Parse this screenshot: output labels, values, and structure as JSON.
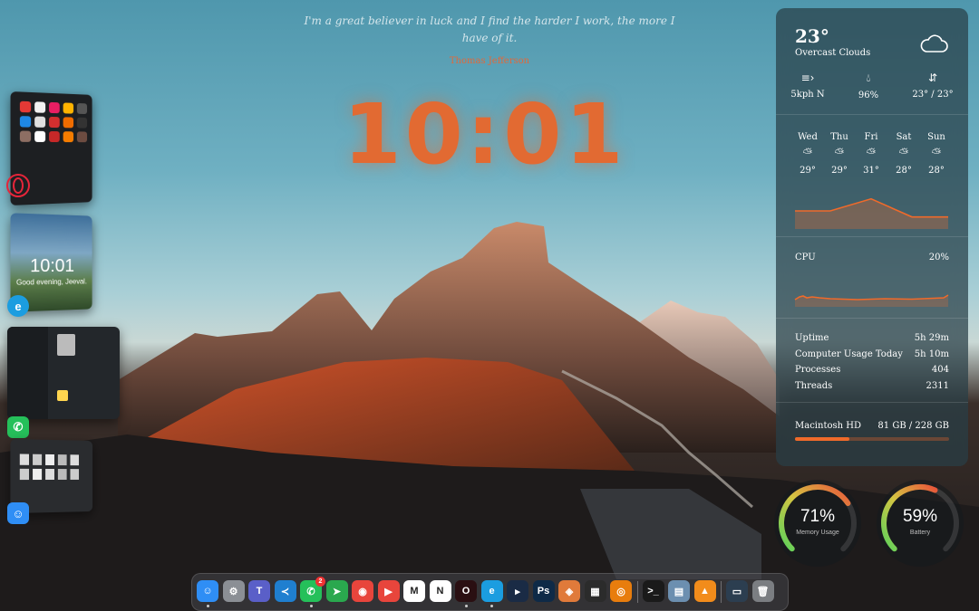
{
  "desktop": {
    "quote": "I'm a great believer in luck and I find the harder I work, the more I have of it.",
    "quote_author": "Thomas Jefferson",
    "clock": "10:01"
  },
  "app_switcher": [
    {
      "app": "Opera",
      "icon": "opera-icon"
    },
    {
      "app": "Microsoft Edge",
      "icon": "edge-icon",
      "window_clock": "10:01",
      "window_greeting": "Good evening, Jeeval."
    },
    {
      "app": "WhatsApp",
      "icon": "whatsapp-icon"
    },
    {
      "app": "Finder",
      "icon": "finder-icon"
    }
  ],
  "weather": {
    "temperature": "23°",
    "condition": "Overcast Clouds",
    "wind": "5kph N",
    "humidity": "96%",
    "range": "23° / 23°",
    "forecast": [
      {
        "day": "Wed",
        "temp": "29°"
      },
      {
        "day": "Thu",
        "temp": "29°"
      },
      {
        "day": "Fri",
        "temp": "31°"
      },
      {
        "day": "Sat",
        "temp": "28°"
      },
      {
        "day": "Sun",
        "temp": "28°"
      }
    ],
    "forecast_values": [
      29,
      29,
      31,
      28,
      28
    ]
  },
  "cpu": {
    "label": "CPU",
    "value": "20%"
  },
  "system": {
    "uptime_label": "Uptime",
    "uptime": "5h 29m",
    "usage_label": "Computer Usage Today",
    "usage": "5h 10m",
    "processes_label": "Processes",
    "processes": "404",
    "threads_label": "Threads",
    "threads": "2311"
  },
  "disk": {
    "label": "Macintosh HD",
    "value": "81 GB / 228 GB",
    "used_fraction": 0.355
  },
  "gauges": {
    "memory": {
      "value": "71%",
      "label": "Memory Usage",
      "fraction": 0.71
    },
    "battery": {
      "value": "59%",
      "label": "Battery",
      "fraction": 0.59
    }
  },
  "dock": [
    {
      "name": "Finder",
      "icon": "finder-icon",
      "color": "#2f8ef5",
      "glyph": "☺",
      "running": true
    },
    {
      "name": "System Settings",
      "icon": "gear-icon",
      "color": "#8b8f95",
      "glyph": "⚙",
      "running": false
    },
    {
      "name": "Teams",
      "icon": "teams-icon",
      "color": "#5a5fc8",
      "glyph": "T",
      "running": false
    },
    {
      "name": "VS Code",
      "icon": "vscode-icon",
      "color": "#1f7fd0",
      "glyph": "≺",
      "running": false
    },
    {
      "name": "WhatsApp",
      "icon": "whatsapp-icon",
      "color": "#25c05a",
      "glyph": "✆",
      "running": true,
      "badge": "2"
    },
    {
      "name": "Telegram",
      "icon": "telegram-icon",
      "color": "#2aa84e",
      "glyph": "➤",
      "running": false
    },
    {
      "name": "Podcasts",
      "icon": "podcast-icon",
      "color": "#e8453c",
      "glyph": "◉",
      "running": false
    },
    {
      "name": "YouTube",
      "icon": "youtube-icon",
      "color": "#e8453c",
      "glyph": "▶",
      "running": false
    },
    {
      "name": "Gmail",
      "icon": "gmail-icon",
      "color": "#ffffff",
      "glyph": "M",
      "running": false
    },
    {
      "name": "Notion",
      "icon": "notion-icon",
      "color": "#ffffff",
      "glyph": "N",
      "running": false
    },
    {
      "name": "Opera",
      "icon": "opera-icon",
      "color": "#2a0f12",
      "glyph": "O",
      "running": true
    },
    {
      "name": "Microsoft Edge",
      "icon": "edge-icon",
      "color": "#1b9de0",
      "glyph": "e",
      "running": true
    },
    {
      "name": "Prime Video",
      "icon": "prime-video-icon",
      "color": "#1a2b45",
      "glyph": "▸",
      "running": false
    },
    {
      "name": "Photoshop",
      "icon": "photoshop-icon",
      "color": "#0e2a47",
      "glyph": "Ps",
      "running": false
    },
    {
      "name": "Pixelmator",
      "icon": "pixelmator-icon",
      "color": "#e07a3a",
      "glyph": "◈",
      "running": false
    },
    {
      "name": "Final Cut Pro",
      "icon": "final-cut-icon",
      "color": "#2b2b2b",
      "glyph": "▦",
      "running": false
    },
    {
      "name": "Blender",
      "icon": "blender-icon",
      "color": "#e87d0d",
      "glyph": "◎",
      "running": false
    },
    {
      "name": "Terminal",
      "icon": "terminal-icon",
      "color": "#1a1a1a",
      "glyph": ">_",
      "running": false
    },
    {
      "name": "Preview",
      "icon": "preview-icon",
      "color": "#6c8fb0",
      "glyph": "▤",
      "running": false
    },
    {
      "name": "VLC",
      "icon": "vlc-icon",
      "color": "#f28c1b",
      "glyph": "▲",
      "running": false
    },
    {
      "name": "Desktop",
      "icon": "desktop-stack-icon",
      "color": "#2c3e50",
      "glyph": "▭",
      "running": false
    },
    {
      "name": "Trash",
      "icon": "trash-icon",
      "color": "#7b7e82",
      "glyph": "🗑",
      "running": false
    }
  ]
}
